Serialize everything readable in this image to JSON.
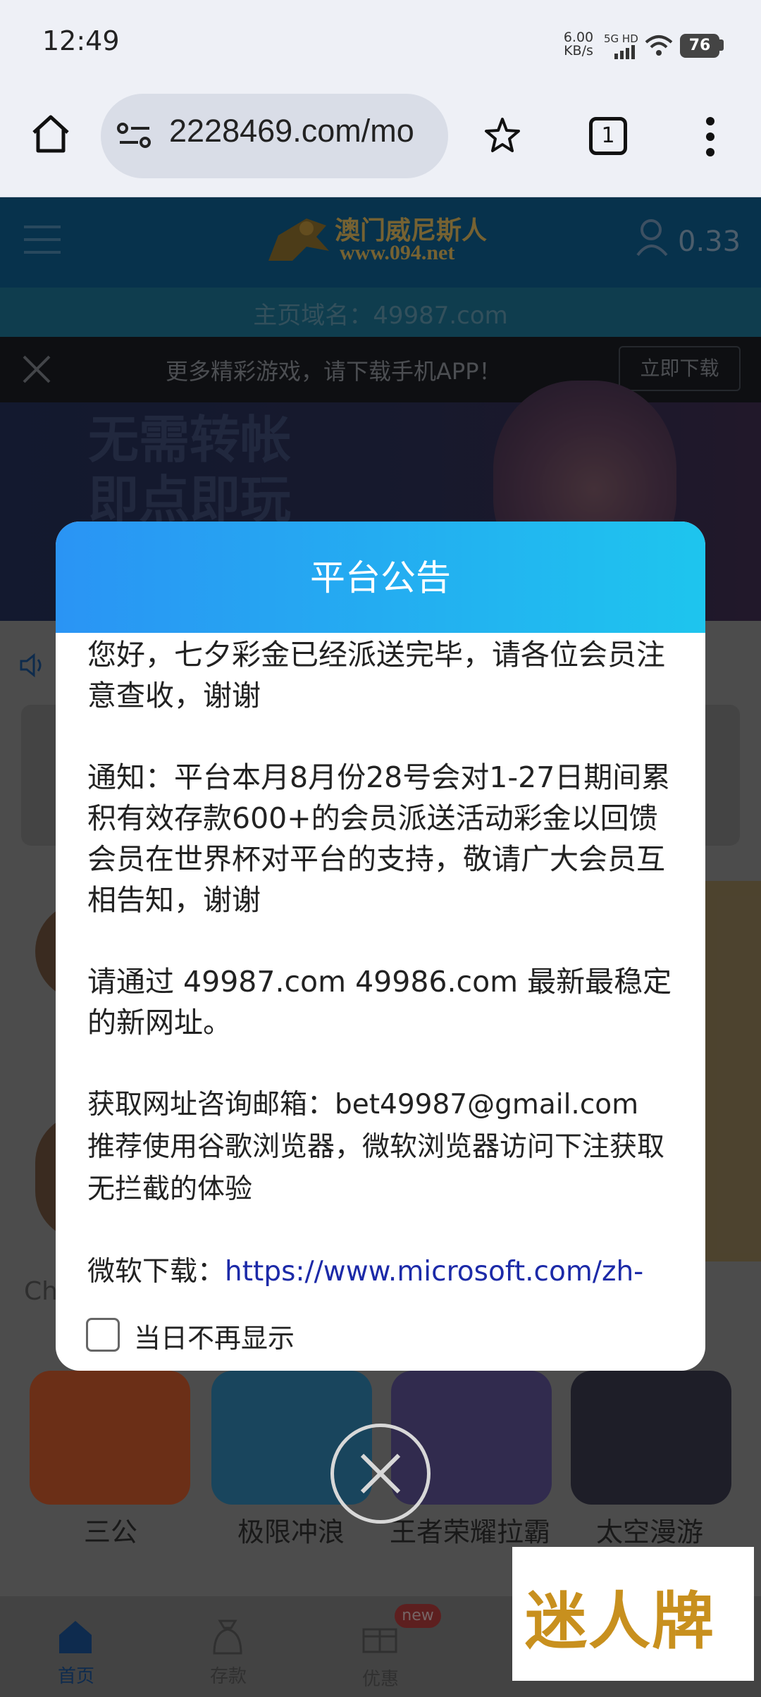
{
  "status_bar": {
    "time": "12:49",
    "net_speed_value": "6.00",
    "net_speed_unit": "KB/s",
    "network": "5G HD",
    "battery": "76"
  },
  "browser": {
    "url": "2228469.com/mo",
    "tab_count": "1"
  },
  "site": {
    "logo_cn": "澳门威尼斯人",
    "logo_url": "www.094.net",
    "balance": "0.33",
    "domain_notice": "主页域名：49987.com",
    "app_banner_text": "更多精彩游戏，请下载手机APP！",
    "app_download_button": "立即下载",
    "banner_line1": "无需转帐",
    "banner_line2": "即点即玩",
    "section_partial": "Ch"
  },
  "games": [
    {
      "label": "三公",
      "color": "#c3572b"
    },
    {
      "label": "极限冲浪",
      "color": "#2f7fa9"
    },
    {
      "label": "王者荣耀拉霸",
      "color": "#5a4f8f"
    },
    {
      "label": "太空漫游",
      "color": "#38384a"
    }
  ],
  "bottom_nav": {
    "home": "首页",
    "deposit": "存款",
    "promo": "优惠",
    "promo_badge": "new"
  },
  "modal": {
    "title": "平台公告",
    "para1": "您好，七夕彩金已经派送完毕，请各位会员注意查收，谢谢",
    "para2": "通知：平台本月8月份28号会对1-27日期间累积有效存款600+的会员派送活动彩金以回馈会员在世界杯对平台的支持，敬请广大会员互相告知，谢谢",
    "para3": "请通过 49987.com 49986.com 最新最稳定的新网址。",
    "para4_line1": "获取网址咨询邮箱：bet49987@gmail.com",
    "para4_line2": "推荐使用谷歌浏览器，微软浏览器访问下注获取无拦截的体验",
    "ms_download_label": "微软下载：",
    "ms_download_link": "https://www.microsoft.com/zh-",
    "dont_show_today": "当日不再显示"
  },
  "watermark": "迷人牌",
  "colors": {
    "modal_header_start": "#2a94f4",
    "modal_header_end": "#1ec5ee",
    "link": "#1c2aa8"
  }
}
